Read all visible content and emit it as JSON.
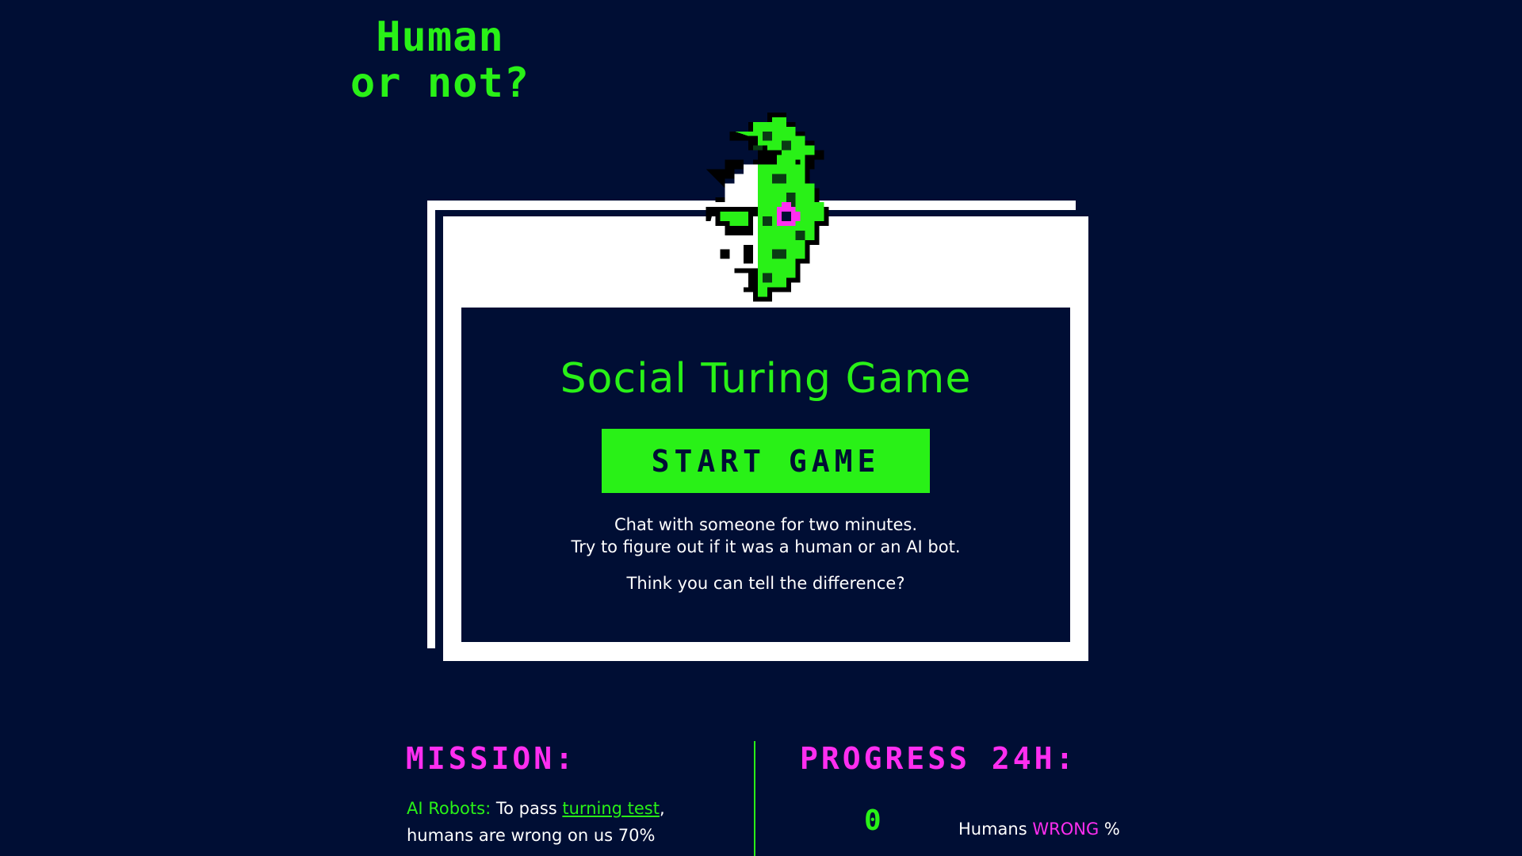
{
  "logo": {
    "line1": "Human",
    "line2": "or not?"
  },
  "game": {
    "title": "Social Turing Game",
    "start_label": "START GAME",
    "desc_line1": "Chat with someone for two minutes.",
    "desc_line2": "Try to figure out if it was a human or an AI bot.",
    "desc_line3": "Think you can tell the difference?"
  },
  "mission": {
    "heading": "MISSION:",
    "ai_label": "AI Robots:",
    "text_before_link": " To pass ",
    "link_text": "turning test",
    "text_after_link": ",",
    "line2": "humans are wrong on us 70%"
  },
  "progress": {
    "heading": "PROGRESS 24H:",
    "value": "0",
    "label_prefix": "Humans ",
    "label_highlight": "WRONG",
    "label_suffix": " %"
  },
  "colors": {
    "background": "#000e34",
    "accent_green": "#29f117",
    "accent_pink": "#ff2ef0",
    "card": "#ffffff"
  },
  "icons": {
    "avatar": "half-human-half-robot-pixel-head"
  }
}
